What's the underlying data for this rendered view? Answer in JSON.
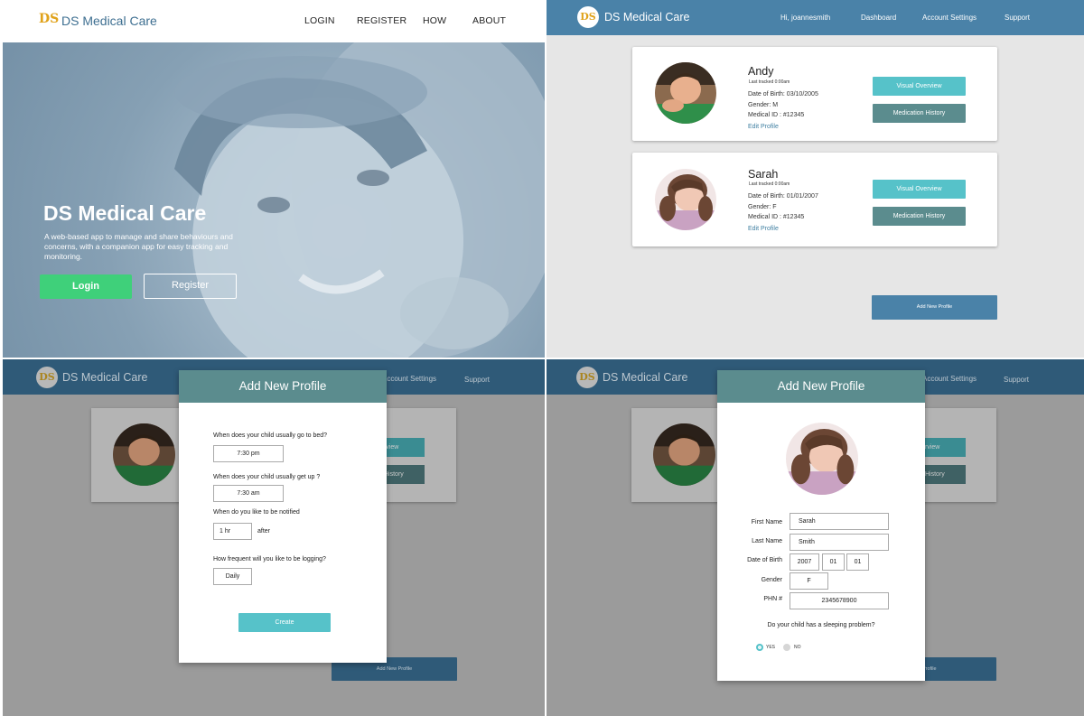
{
  "brand": {
    "name": "DS Medical Care",
    "logo_text": "DS",
    "logo_color": "#e0a21a"
  },
  "landing": {
    "nav": [
      "LOGIN",
      "REGISTER",
      "HOW",
      "ABOUT"
    ],
    "hero_title": "DS Medical Care",
    "hero_desc": "A web-based app to manage and share behaviours and concerns, with a companion app for easy tracking and monitoring.",
    "login_label": "Login",
    "register_label": "Register"
  },
  "dashboard": {
    "nav": [
      "Hi, joannesmith",
      "Dashboard",
      "Account Settings",
      "Support"
    ],
    "profiles": [
      {
        "name": "Andy",
        "tracked": "Last tracked 0:00am",
        "dob": "Date of Birth: 03/10/2005",
        "gender": "Gender: M",
        "medical_id": "Medical ID : #12345",
        "edit": "Edit Profile"
      },
      {
        "name": "Sarah",
        "tracked": "Last tracked 0:00am",
        "dob": "Date of Birth: 01/01/2007",
        "gender": "Gender: F",
        "medical_id": "Medical ID : #12345",
        "edit": "Edit Profile"
      }
    ],
    "visual_label": "Visual Overview",
    "medication_label": "Medication History",
    "add_label": "Add New Profile",
    "dim_nav": [
      "Account Settings",
      "Support"
    ],
    "dim_btn_a": "rview",
    "dim_btn_b": "History",
    "dim_add_p3": "Add New Profile",
    "dim_add_p4": "Profile"
  },
  "schedule_modal": {
    "title": "Add New Profile",
    "q_bed": "When does your child usually go to bed?",
    "bed_value": "7:30 pm",
    "q_up": "When does your child usually get up ?",
    "up_value": "7:30 am",
    "q_notify": "When do you like to be notified",
    "notify_value": "1 hr",
    "notify_after": "after",
    "q_freq": "How frequent will you like to be logging?",
    "freq_value": "Daily",
    "create_label": "Create"
  },
  "profile_modal": {
    "title": "Add New Profile",
    "first_name_label": "First Name",
    "first_name": "Sarah",
    "last_name_label": "Last Name",
    "last_name": "Smith",
    "dob_label": "Date of Birth",
    "dob_year": "2007",
    "dob_month": "01",
    "dob_day": "01",
    "gender_label": "Gender",
    "gender": "F",
    "phn_label": "PHN #",
    "phn": "2345678900",
    "sleep_q": "Do your child has a sleeping problem?",
    "yes": "YES",
    "no": "NO"
  },
  "colors": {
    "nav_blue": "#4a82a8",
    "teal": "#56c2c9",
    "slate_teal": "#5b8c8e",
    "green": "#3fd07a"
  }
}
